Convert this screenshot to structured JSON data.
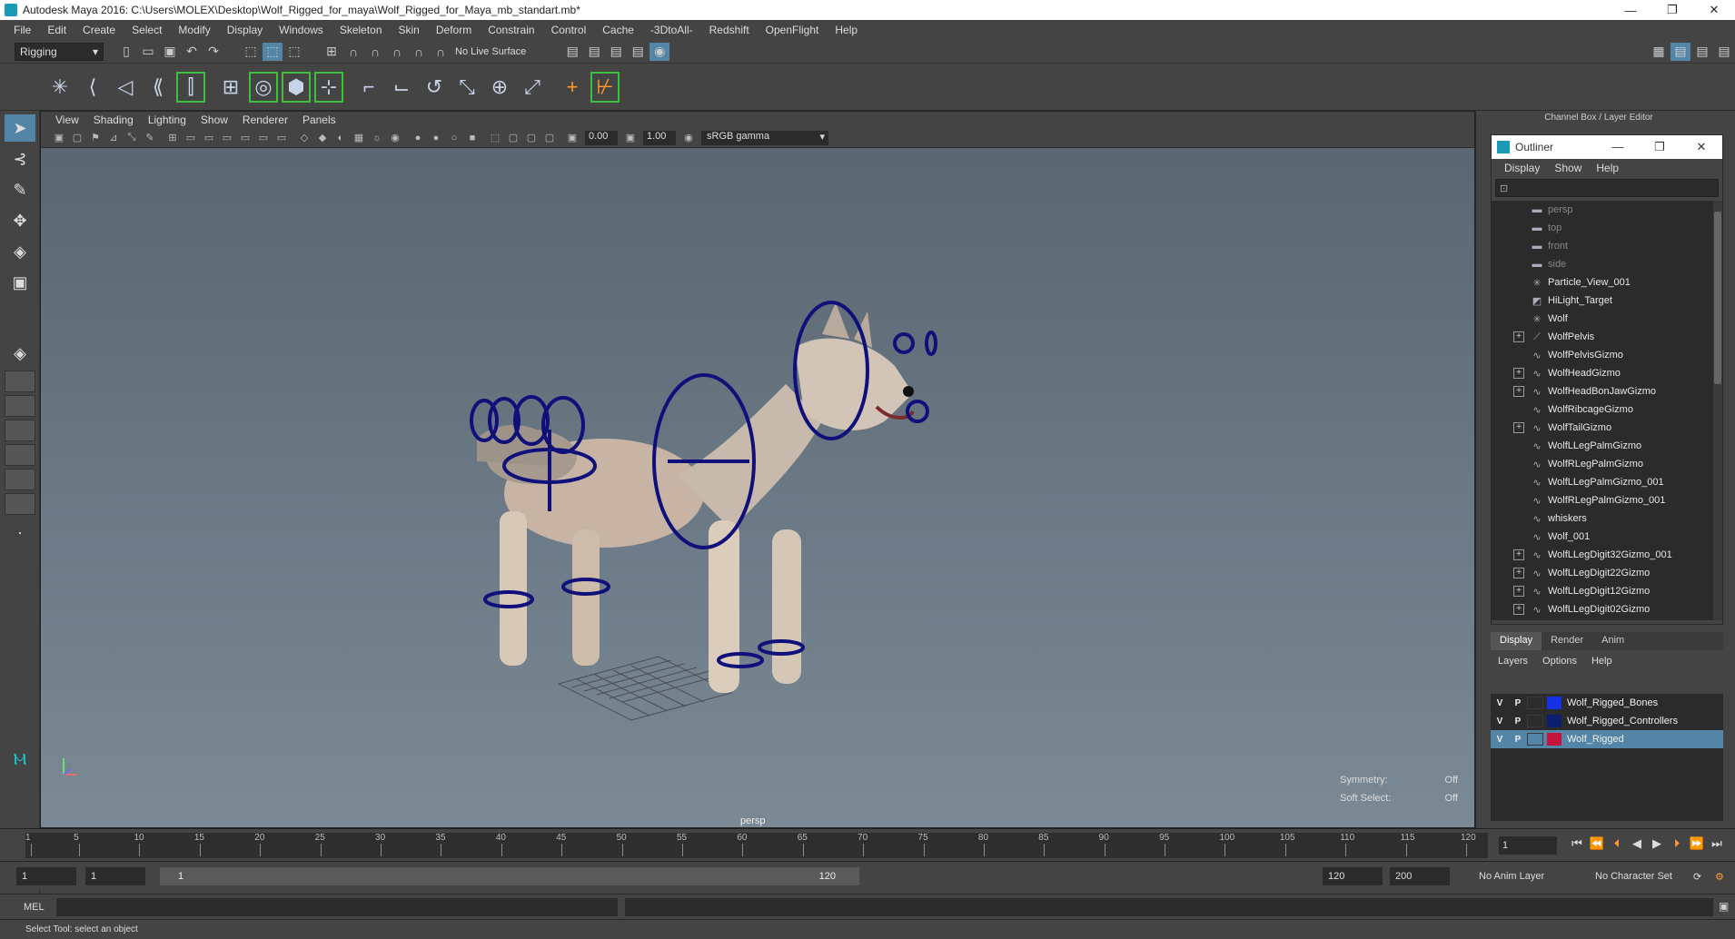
{
  "window": {
    "title": "Autodesk Maya 2016: C:\\Users\\MOLEX\\Desktop\\Wolf_Rigged_for_maya\\Wolf_Rigged_for_Maya_mb_standart.mb*",
    "minimize": "—",
    "restore": "❐",
    "close": "✕"
  },
  "menubar": [
    "File",
    "Edit",
    "Create",
    "Select",
    "Modify",
    "Display",
    "Windows",
    "Skeleton",
    "Skin",
    "Deform",
    "Constrain",
    "Control",
    "Cache",
    "-3DtoAll-",
    "Redshift",
    "OpenFlight",
    "Help"
  ],
  "statusline": {
    "mode": "Rigging",
    "live_surface": "No Live Surface"
  },
  "viewport": {
    "menu": [
      "View",
      "Shading",
      "Lighting",
      "Show",
      "Renderer",
      "Panels"
    ],
    "exposure": "0.00",
    "gamma_value": "1.00",
    "color_space": "sRGB gamma",
    "camera": "persp",
    "hud": {
      "symmetry_label": "Symmetry:",
      "symmetry_value": "Off",
      "soft_select_label": "Soft Select:",
      "soft_select_value": "Off"
    }
  },
  "channel_box_title": "Channel Box / Layer Editor",
  "outliner": {
    "title": "Outliner",
    "menu": [
      "Display",
      "Show",
      "Help"
    ],
    "items": [
      {
        "label": "persp",
        "icon": "camera-icon",
        "expandable": false,
        "dim": true
      },
      {
        "label": "top",
        "icon": "camera-icon",
        "expandable": false,
        "dim": true
      },
      {
        "label": "front",
        "icon": "camera-icon",
        "expandable": false,
        "dim": true
      },
      {
        "label": "side",
        "icon": "camera-icon",
        "expandable": false,
        "dim": true
      },
      {
        "label": "Particle_View_001",
        "icon": "star-icon",
        "expandable": false,
        "dim": false
      },
      {
        "label": "HiLight_Target",
        "icon": "target-icon",
        "expandable": false,
        "dim": false
      },
      {
        "label": "Wolf",
        "icon": "star-icon",
        "expandable": false,
        "dim": false
      },
      {
        "label": "WolfPelvis",
        "icon": "joint-icon",
        "expandable": true,
        "dim": false
      },
      {
        "label": "WolfPelvisGizmo",
        "icon": "curve-icon",
        "expandable": false,
        "dim": false
      },
      {
        "label": "WolfHeadGizmo",
        "icon": "curve-icon",
        "expandable": true,
        "dim": false
      },
      {
        "label": "WolfHeadBonJawGizmo",
        "icon": "curve-icon",
        "expandable": true,
        "dim": false
      },
      {
        "label": "WolfRibcageGizmo",
        "icon": "curve-icon",
        "expandable": false,
        "dim": false
      },
      {
        "label": "WolfTailGizmo",
        "icon": "curve-icon",
        "expandable": true,
        "dim": false
      },
      {
        "label": "WolfLLegPalmGizmo",
        "icon": "curve-icon",
        "expandable": false,
        "dim": false
      },
      {
        "label": "WolfRLegPalmGizmo",
        "icon": "curve-icon",
        "expandable": false,
        "dim": false
      },
      {
        "label": "WolfLLegPalmGizmo_001",
        "icon": "curve-icon",
        "expandable": false,
        "dim": false
      },
      {
        "label": "WolfRLegPalmGizmo_001",
        "icon": "curve-icon",
        "expandable": false,
        "dim": false
      },
      {
        "label": "whiskers",
        "icon": "curve-icon",
        "expandable": false,
        "dim": false
      },
      {
        "label": "Wolf_001",
        "icon": "curve-icon",
        "expandable": false,
        "dim": false
      },
      {
        "label": "WolfLLegDigit32Gizmo_001",
        "icon": "curve-icon",
        "expandable": true,
        "dim": false
      },
      {
        "label": "WolfLLegDigit22Gizmo",
        "icon": "curve-icon",
        "expandable": true,
        "dim": false
      },
      {
        "label": "WolfLLegDigit12Gizmo",
        "icon": "curve-icon",
        "expandable": true,
        "dim": false
      },
      {
        "label": "WolfLLegDigit02Gizmo",
        "icon": "curve-icon",
        "expandable": true,
        "dim": false
      }
    ]
  },
  "layer_editor": {
    "tabs": [
      "Display",
      "Render",
      "Anim"
    ],
    "menu": [
      "Layers",
      "Options",
      "Help"
    ],
    "layers": [
      {
        "visible": "V",
        "playback": "P",
        "name": "Wolf_Rigged_Bones",
        "color": "#1530e8",
        "selected": false
      },
      {
        "visible": "V",
        "playback": "P",
        "name": "Wolf_Rigged_Controllers",
        "color": "#0b1f6e",
        "selected": false
      },
      {
        "visible": "V",
        "playback": "P",
        "name": "Wolf_Rigged",
        "color": "#c4143c",
        "selected": true
      }
    ]
  },
  "timeline": {
    "ticks": [
      "1",
      "5",
      "10",
      "15",
      "20",
      "25",
      "30",
      "35",
      "40",
      "45",
      "50",
      "55",
      "60",
      "65",
      "70",
      "75",
      "80",
      "85",
      "90",
      "95",
      "100",
      "105",
      "110",
      "115",
      "120"
    ],
    "current_frame": "1"
  },
  "range": {
    "start": "1",
    "anim_start": "1",
    "slider_start": "1",
    "slider_end": "120",
    "anim_end": "120",
    "end": "200",
    "anim_layer": "No Anim Layer",
    "character_set": "No Character Set"
  },
  "command_line": {
    "language": "MEL"
  },
  "help_line": "Select Tool: select an object"
}
